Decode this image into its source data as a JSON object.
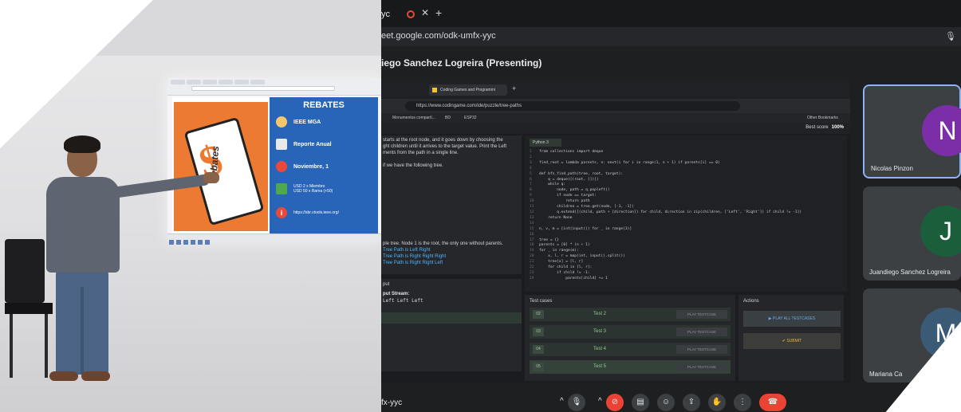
{
  "slide": {
    "title": "REBATES",
    "sign_text": "Rebates",
    "rows": [
      {
        "icon": "person-icon",
        "text": "IEEE MGA"
      },
      {
        "icon": "report-icon",
        "text": "Reporte Anual"
      },
      {
        "icon": "calendar-icon",
        "text": "Noviembre, 1"
      },
      {
        "icon": "money-icon",
        "line1": "USD 2 x Miembro",
        "line2": "USD 50 x Rama (+50)"
      },
      {
        "icon": "info-icon",
        "text": "https://sbr.vtools.ieee.org/"
      }
    ]
  },
  "meet": {
    "tab_label": "yc",
    "url": "eet.google.com/odk-umfx-yyc",
    "presenter_title": "iego Sanchez Logreira (Presenting)",
    "meeting_code": "fx-yyc",
    "participants": [
      {
        "initial": "N",
        "name": "Nicolas Pinzon",
        "color": "#7b2ea8",
        "selected": true
      },
      {
        "initial": "J",
        "name": "Juandiego Sanchez Logreira",
        "color": "#1b5e3b",
        "selected": false
      },
      {
        "initial": "M",
        "name": "Mariana Ca",
        "color": "#3b5a76",
        "selected": false
      }
    ]
  },
  "shared": {
    "tab_title": "Coding Games and Programmi",
    "url": "https://www.codingame.com/ide/puzzle/tree-paths",
    "bookmarks": [
      "Monumentos compartí...",
      "BD",
      "ESP32",
      "Other Bookmarks"
    ],
    "best_score_label": "Best score",
    "best_score_value": "100%",
    "statement": [
      "starts at the root node, and it goes down by choosing the",
      "ght children until it arrives to the target value. Print the Left",
      "ments from the path in a single line.",
      "",
      "if we have the following tree.",
      "",
      "ple tree. Node 1 is the root, the only one without parents.",
      "Tree Path is Left Right",
      "Tree Path is Right Right Right",
      "Tree Path is Right Right Left"
    ],
    "output_label": "put",
    "output_stream_label": "put Stream:",
    "output_value": "Left Left Left",
    "language": "Python 3",
    "code": [
      "from collections import deque",
      "",
      "find_root = lambda parents, n: next(i for i in range(1, n + 1) if parents[i] == 0)",
      "",
      "def bfs_find_path(tree, root, target):",
      "    q = deque([(root, [])])",
      "    while q:",
      "        node, path = q.popleft()",
      "        if node == target:",
      "            return path",
      "        children = tree.get(node, [-1, -1])",
      "        q.extend([(child, path + [direction]) for child, direction in zip(children, ['Left', 'Right']) if child != -1])",
      "    return None",
      "",
      "n, v, m = [int(input()) for _ in range(3)]",
      "",
      "tree = {}",
      "parents = [0] * (n + 1)",
      "for _ in range(m):",
      "    x, l, r = map(int, input().split())",
      "    tree[x] = [l, r]",
      "    for child in [l, r]:",
      "        if child != -1:",
      "            parents[child] += 1"
    ],
    "test_cases_title": "Test cases",
    "test_cases": [
      {
        "num": "02",
        "name": "Test 2",
        "button": "PLAY TESTCASE"
      },
      {
        "num": "03",
        "name": "Test 3",
        "button": "PLAY TESTCASE"
      },
      {
        "num": "04",
        "name": "Test 4",
        "button": "PLAY TESTCASE"
      },
      {
        "num": "05",
        "name": "Test 5",
        "button": "PLAY TESTCASE"
      }
    ],
    "actions_title": "Actions",
    "play_all_label": "PLAY ALL TESTCASES",
    "submit_label": "SUBMIT"
  },
  "colors": {
    "meet_bg": "#1e1f21",
    "accent_blue": "#8ab4f8",
    "hangup_red": "#ea4335",
    "slide_orange": "#ec7a33",
    "slide_blue": "#2864b8"
  }
}
